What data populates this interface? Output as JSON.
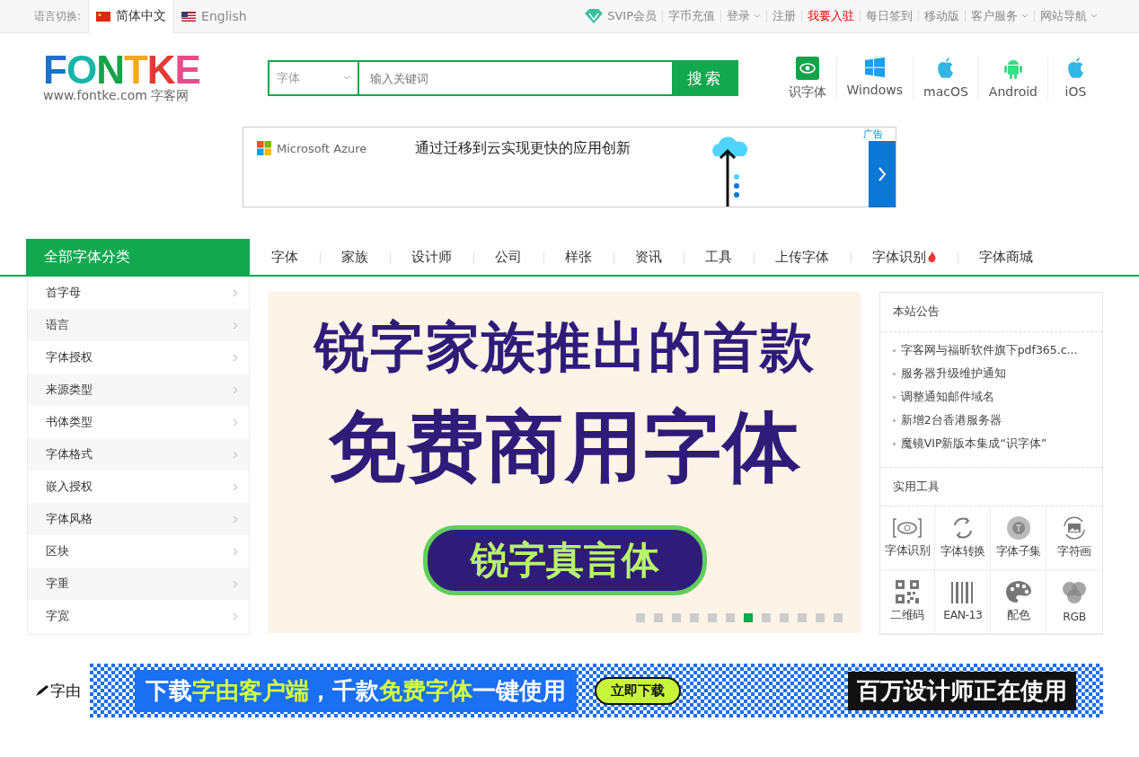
{
  "topbar": {
    "lang_label": "语言切换:",
    "languages": [
      {
        "label": "简体中文",
        "selected": true
      },
      {
        "label": "English",
        "selected": false
      }
    ],
    "links": [
      {
        "label": "SVIP会员",
        "kind": "svip"
      },
      {
        "label": "字币充值",
        "kind": "plain"
      },
      {
        "label": "登录",
        "kind": "dropdown"
      },
      {
        "label": "注册",
        "kind": "plain"
      },
      {
        "label": "我要入驻",
        "kind": "highlight"
      },
      {
        "label": "每日签到",
        "kind": "plain"
      },
      {
        "label": "移动版",
        "kind": "plain"
      },
      {
        "label": "客户服务",
        "kind": "dropdown"
      },
      {
        "label": "网站导航",
        "kind": "dropdown"
      }
    ]
  },
  "header": {
    "logo": {
      "wordmark": "FONTKE",
      "url": "www.fontke.com",
      "name": "字客网"
    },
    "search": {
      "category": "字体",
      "placeholder": "输入关键词",
      "button": "搜索"
    },
    "platforms": [
      {
        "label": "识字体",
        "kind": "eye"
      },
      {
        "label": "Windows",
        "kind": "windows"
      },
      {
        "label": "macOS",
        "kind": "apple"
      },
      {
        "label": "Android",
        "kind": "android"
      },
      {
        "label": "iOS",
        "kind": "apple"
      }
    ]
  },
  "ad": {
    "brand": "Microsoft Azure",
    "text": "通过迁移到云实现更快的应用创新",
    "badge": "广告"
  },
  "nav": {
    "all_categories": "全部字体分类",
    "items": [
      {
        "label": "字体",
        "hot": false
      },
      {
        "label": "家族",
        "hot": false
      },
      {
        "label": "设计师",
        "hot": false
      },
      {
        "label": "公司",
        "hot": false
      },
      {
        "label": "样张",
        "hot": false
      },
      {
        "label": "资讯",
        "hot": false
      },
      {
        "label": "工具",
        "hot": false
      },
      {
        "label": "上传字体",
        "hot": false
      },
      {
        "label": "字体识别",
        "hot": true
      },
      {
        "label": "字体商城",
        "hot": false
      }
    ]
  },
  "sidebar": {
    "items": [
      "首字母",
      "语言",
      "字体授权",
      "来源类型",
      "书体类型",
      "字体格式",
      "嵌入授权",
      "字体风格",
      "区块",
      "字重",
      "字宽"
    ]
  },
  "slider": {
    "headline": "锐字家族推出的首款",
    "title": "免费商用字体",
    "badge": "锐字真言体",
    "dots": [
      {
        "selected": false
      },
      {
        "selected": false
      },
      {
        "selected": false
      },
      {
        "selected": false
      },
      {
        "selected": false
      },
      {
        "selected": false
      },
      {
        "selected": true
      },
      {
        "selected": false
      },
      {
        "selected": false
      },
      {
        "selected": false
      },
      {
        "selected": false
      },
      {
        "selected": false
      }
    ]
  },
  "notices": {
    "title": "本站公告",
    "items": [
      "字客网与福昕软件旗下pdf365.c...",
      "服务器升级维护通知",
      "调整通知邮件域名",
      "新增2台香港服务器",
      "魔镜VIP新版本集成“识字体”"
    ],
    "tools_title": "实用工具",
    "tools": [
      {
        "label": "字体识别",
        "kind": "eye"
      },
      {
        "label": "字体转换",
        "kind": "convert"
      },
      {
        "label": "字体子集",
        "kind": "subset"
      },
      {
        "label": "字符画",
        "kind": "image"
      },
      {
        "label": "二维码",
        "kind": "qr"
      },
      {
        "label": "EAN-13",
        "kind": "barcode"
      },
      {
        "label": "配色",
        "kind": "palette"
      },
      {
        "label": "RGB",
        "kind": "rgb"
      }
    ]
  },
  "promo": {
    "logo": "字由",
    "parts": [
      {
        "text": "下载",
        "highlight": false
      },
      {
        "text": "字由客户端",
        "highlight": true
      },
      {
        "text": "，千款",
        "highlight": false
      },
      {
        "text": "免费字体",
        "highlight": true
      },
      {
        "text": "一键使用",
        "highlight": false
      }
    ],
    "cta": "立即下载",
    "tagline": "百万设计师正在使用"
  }
}
